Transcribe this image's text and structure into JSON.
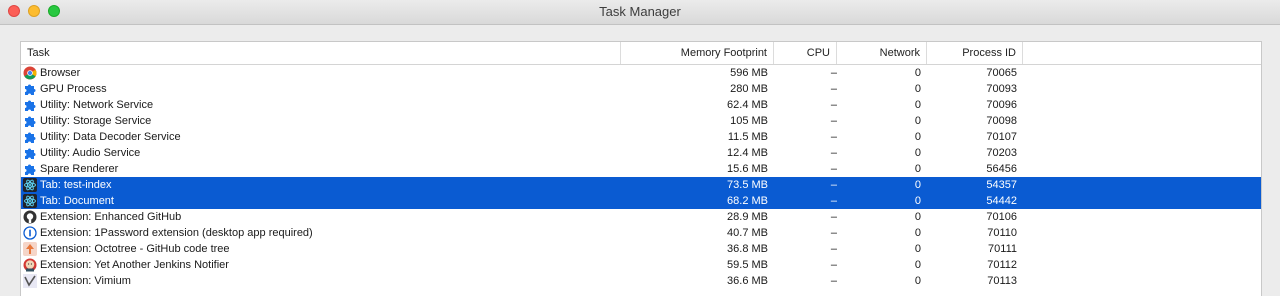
{
  "window": {
    "title": "Task Manager"
  },
  "columns": {
    "task": "Task",
    "memory": "Memory Footprint",
    "cpu": "CPU",
    "network": "Network",
    "pid": "Process ID"
  },
  "rows": [
    {
      "icon": "chrome-icon",
      "task": "Browser",
      "memory": "596 MB",
      "cpu": "–",
      "network": "0",
      "pid": "70065",
      "selected": false
    },
    {
      "icon": "puzzle-icon",
      "task": "GPU Process",
      "memory": "280 MB",
      "cpu": "–",
      "network": "0",
      "pid": "70093",
      "selected": false
    },
    {
      "icon": "puzzle-icon",
      "task": "Utility: Network Service",
      "memory": "62.4 MB",
      "cpu": "–",
      "network": "0",
      "pid": "70096",
      "selected": false
    },
    {
      "icon": "puzzle-icon",
      "task": "Utility: Storage Service",
      "memory": "105 MB",
      "cpu": "–",
      "network": "0",
      "pid": "70098",
      "selected": false
    },
    {
      "icon": "puzzle-icon",
      "task": "Utility: Data Decoder Service",
      "memory": "11.5 MB",
      "cpu": "–",
      "network": "0",
      "pid": "70107",
      "selected": false
    },
    {
      "icon": "puzzle-icon",
      "task": "Utility: Audio Service",
      "memory": "12.4 MB",
      "cpu": "–",
      "network": "0",
      "pid": "70203",
      "selected": false
    },
    {
      "icon": "puzzle-icon",
      "task": "Spare Renderer",
      "memory": "15.6 MB",
      "cpu": "–",
      "network": "0",
      "pid": "56456",
      "selected": false
    },
    {
      "icon": "react-icon",
      "task": "Tab: test-index",
      "memory": "73.5 MB",
      "cpu": "–",
      "network": "0",
      "pid": "54357",
      "selected": true
    },
    {
      "icon": "react-icon",
      "task": "Tab: Document",
      "memory": "68.2 MB",
      "cpu": "–",
      "network": "0",
      "pid": "54442",
      "selected": true
    },
    {
      "icon": "github-icon",
      "task": "Extension: Enhanced GitHub",
      "memory": "28.9 MB",
      "cpu": "–",
      "network": "0",
      "pid": "70106",
      "selected": false
    },
    {
      "icon": "onepassword-icon",
      "task": "Extension: 1Password extension (desktop app required)",
      "memory": "40.7 MB",
      "cpu": "–",
      "network": "0",
      "pid": "70110",
      "selected": false
    },
    {
      "icon": "octotree-icon",
      "task": "Extension: Octotree - GitHub code tree",
      "memory": "36.8 MB",
      "cpu": "–",
      "network": "0",
      "pid": "70111",
      "selected": false
    },
    {
      "icon": "jenkins-icon",
      "task": "Extension: Yet Another Jenkins Notifier",
      "memory": "59.5 MB",
      "cpu": "–",
      "network": "0",
      "pid": "70112",
      "selected": false
    },
    {
      "icon": "vimium-icon",
      "task": "Extension: Vimium",
      "memory": "36.6 MB",
      "cpu": "–",
      "network": "0",
      "pid": "70113",
      "selected": false
    }
  ],
  "colors": {
    "selection": "#0a5bd2",
    "puzzle": "#1a73e8"
  }
}
